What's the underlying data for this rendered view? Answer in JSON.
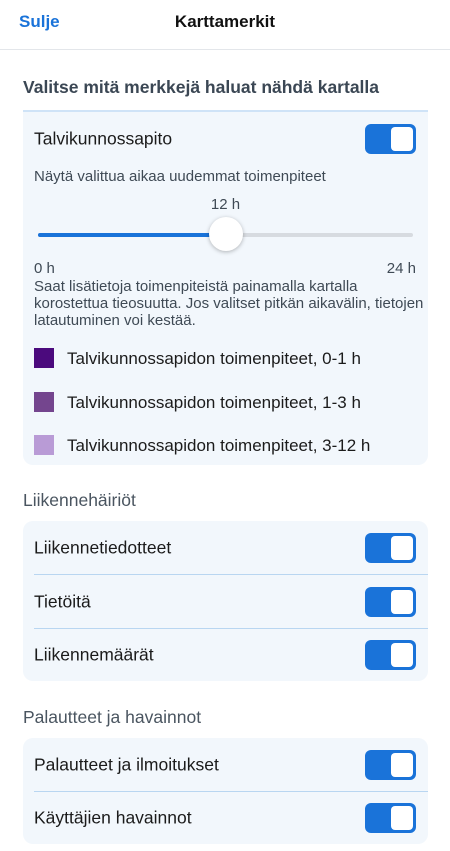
{
  "header": {
    "close_label": "Sulje",
    "title": "Karttamerkit"
  },
  "intro": "Valitse mitä merkkejä haluat nähdä kartalla",
  "winter": {
    "title": "Talvikunnossapito",
    "toggle_on": true,
    "description": "Näytä valittua aikaa uudemmat toimenpiteet",
    "slider": {
      "value_label": "12 h",
      "value_fraction": 0.5,
      "min_label": "0 h",
      "max_label": "24 h"
    },
    "info": "Saat lisätietoja toimenpiteistä painamalla kartalla korostettua tieosuutta. Jos valitset pitkän aikavälin, tietojen latautuminen voi kestää.",
    "legend": [
      {
        "label": "Talvikunnossapidon toimenpiteet, 0-1 h",
        "color": "#4b0a7d"
      },
      {
        "label": "Talvikunnossapidon toimenpiteet, 1-3 h",
        "color": "#74458e"
      },
      {
        "label": "Talvikunnossapidon toimenpiteet, 3-12 h",
        "color": "#b99bd6"
      }
    ]
  },
  "traffic": {
    "title": "Liikennehäiriöt",
    "items": [
      {
        "label": "Liikennetiedotteet",
        "on": true
      },
      {
        "label": "Tietöitä",
        "on": true
      },
      {
        "label": "Liikennemäärät",
        "on": true
      }
    ]
  },
  "feedback": {
    "title": "Palautteet ja havainnot",
    "items": [
      {
        "label": "Palautteet ja ilmoitukset",
        "on": true
      },
      {
        "label": "Käyttäjien havainnot",
        "on": true
      }
    ]
  },
  "colors": {
    "accent": "#1a73d9",
    "card_background": "#f2f7fc"
  }
}
